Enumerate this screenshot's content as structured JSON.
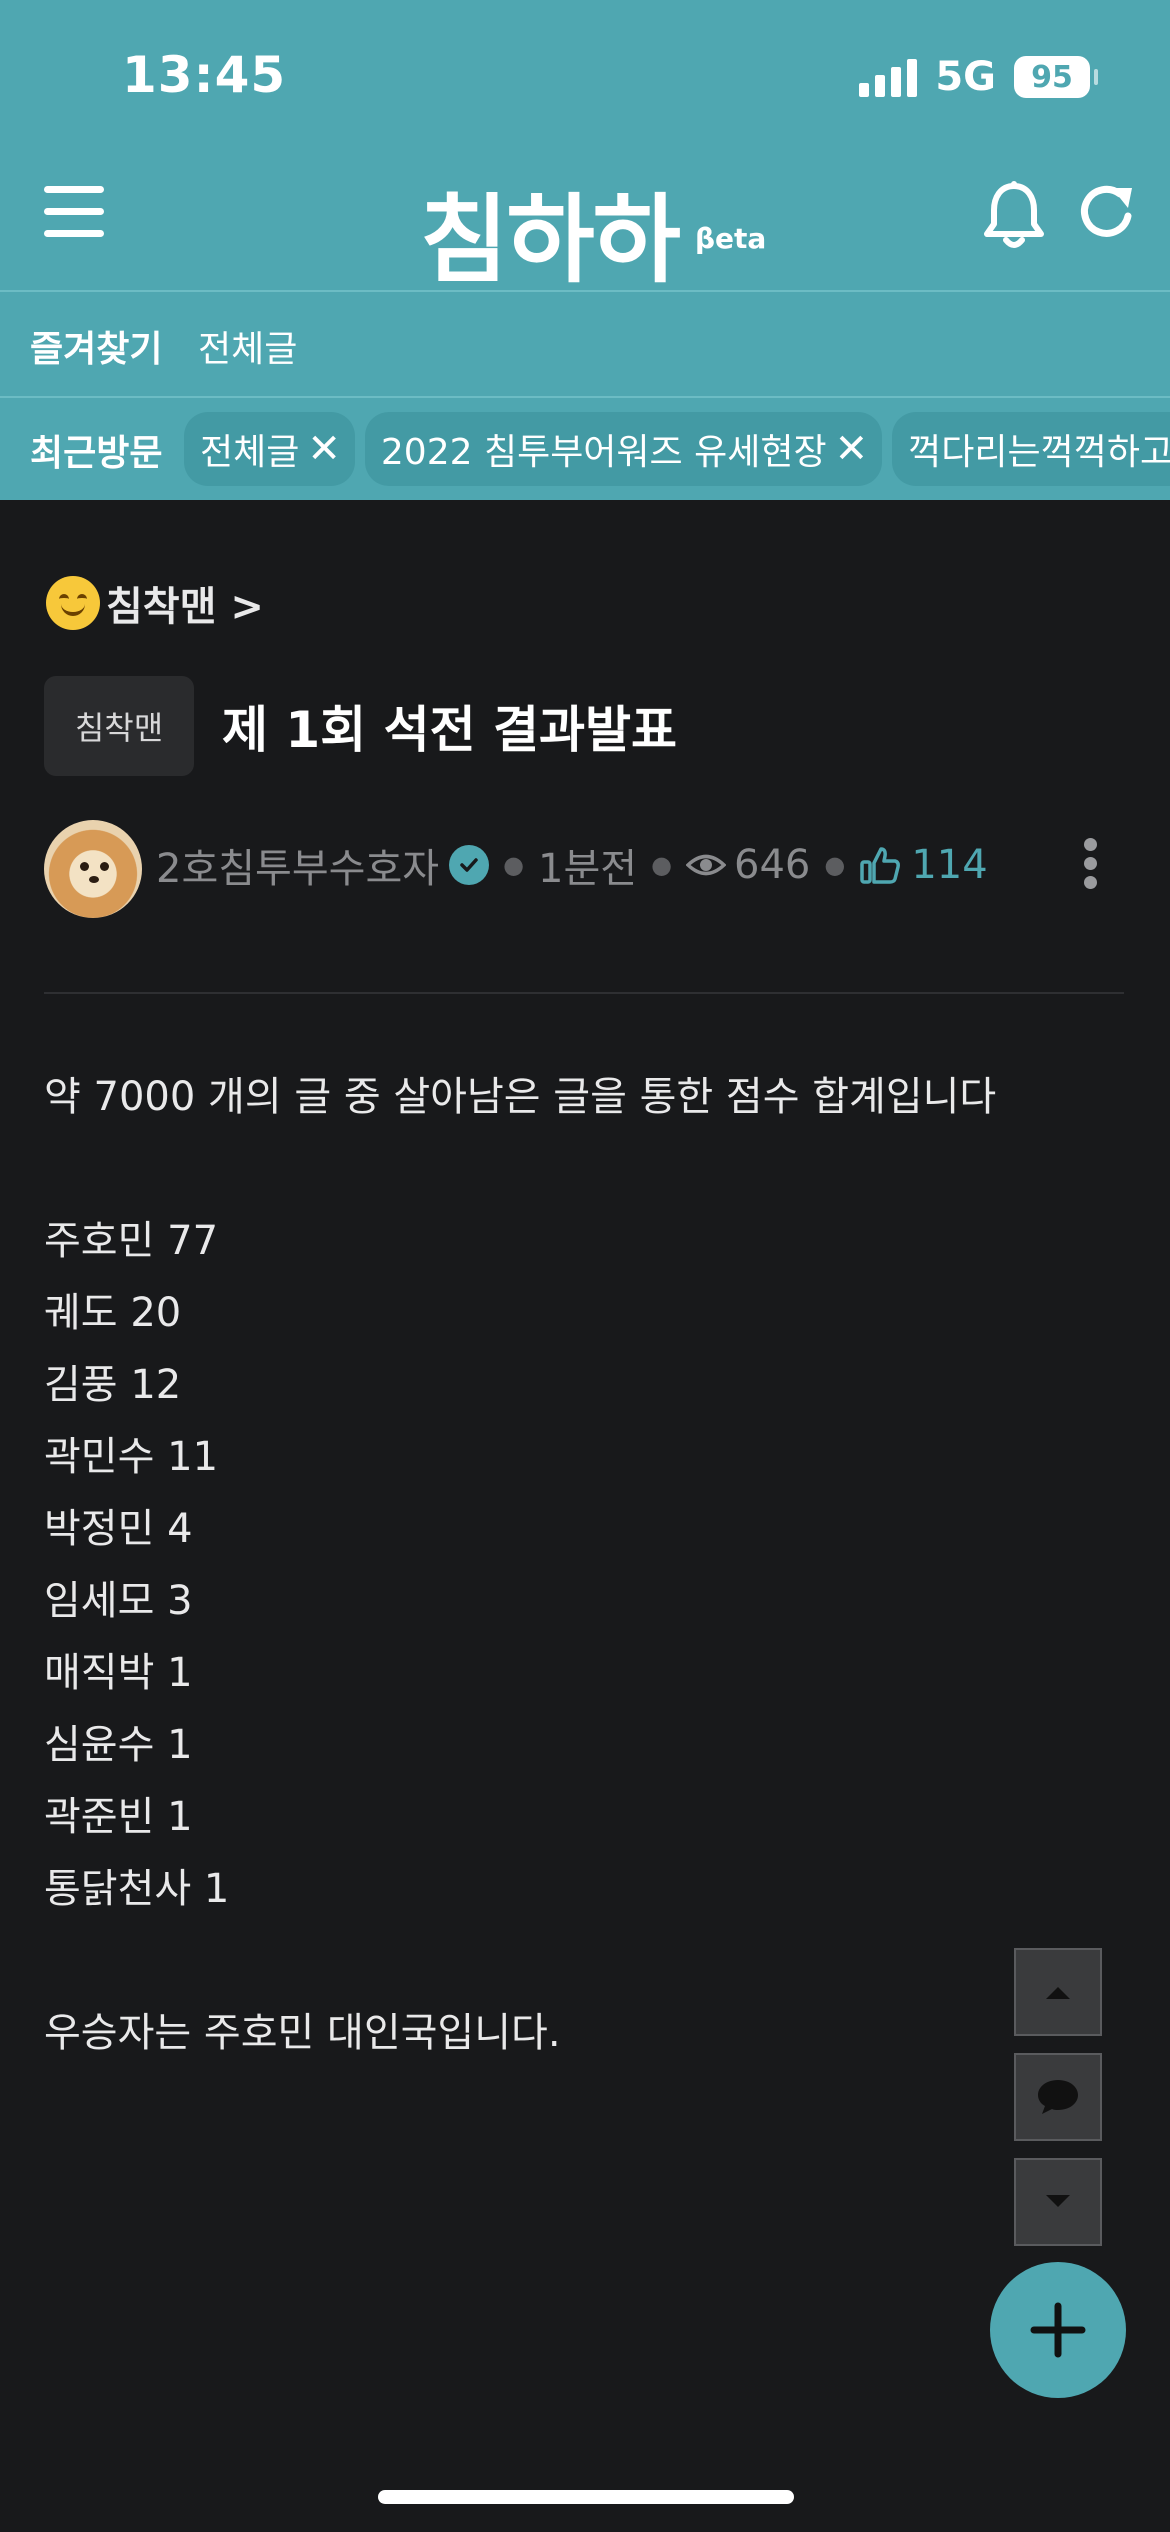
{
  "status_bar": {
    "time": "13:45",
    "network": "5G",
    "battery": "95"
  },
  "header": {
    "logo": "침하하",
    "logo_badge": "βeta",
    "icons": [
      "menu-icon",
      "bell-icon",
      "refresh-icon"
    ]
  },
  "favorites": {
    "label": "즐겨찾기",
    "items": [
      "전체글"
    ]
  },
  "recent": {
    "label": "최근방문",
    "chips": [
      {
        "label": "전체글"
      },
      {
        "label": "2022 침투부어워즈 유세현장"
      },
      {
        "label": "꺽다리는꺽꺽하고웃"
      }
    ]
  },
  "post": {
    "board": "침착맨 >",
    "category": "침착맨",
    "title": "제 1회 석전 결과발표",
    "author": "2호침투부수호자",
    "time": "1분전",
    "views": "646",
    "likes": "114",
    "intro": "약 7000 개의 글 중 살아남은 글을 통한 점수 합계입니다",
    "results": [
      "주호민 77",
      "궤도 20",
      "김풍 12",
      "곽민수 11",
      "박정민 4",
      "임세모 3",
      "매직박 1",
      "심윤수 1",
      "곽준빈 1",
      "통닭천사 1"
    ],
    "conclusion": "우승자는 주호민 대인국입니다."
  },
  "colors": {
    "brand": "#4fa7b1",
    "background": "#18191b"
  }
}
